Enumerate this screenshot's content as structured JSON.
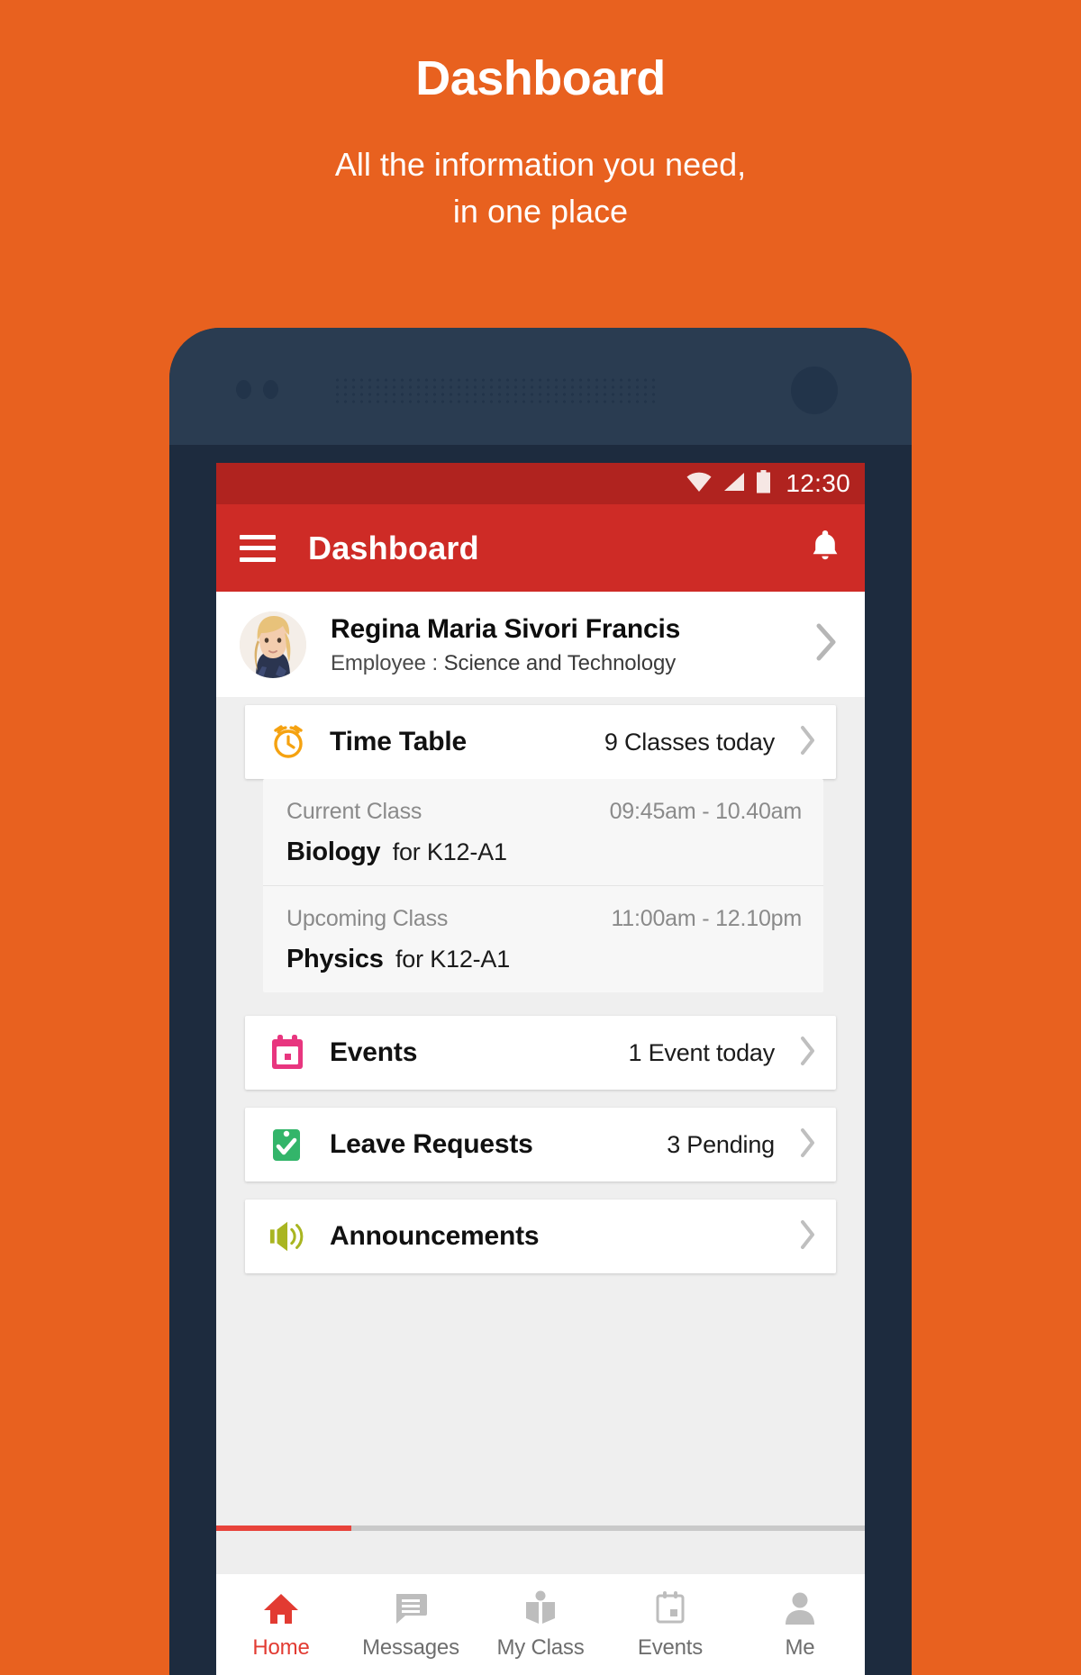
{
  "promo": {
    "title": "Dashboard",
    "subtitle_line1": "All the information you need,",
    "subtitle_line2": "in one place"
  },
  "colors": {
    "background": "#E8611F",
    "phone_frame": "#1D2B3E",
    "phone_frame_top": "#2A3C51",
    "statusbar": "#B0231F",
    "appbar": "#CE2B26",
    "accent_red": "#E23B32",
    "timetable_icon": "#F5A210",
    "events_icon": "#E8367F",
    "leave_icon": "#33B56A",
    "announcements_icon": "#A9B521"
  },
  "statusbar": {
    "time": "12:30",
    "icons": [
      "wifi-icon",
      "cellular-signal-icon",
      "battery-icon"
    ]
  },
  "appbar": {
    "menu_icon": "hamburger-menu-icon",
    "title": "Dashboard",
    "notification_icon": "bell-icon"
  },
  "profile": {
    "avatar": "user-avatar-photo",
    "name": "Regina Maria Sivori Francis",
    "role_label": "Employee :",
    "department": "Science and Technology",
    "chevron": "chevron-right-icon"
  },
  "cards": {
    "timetable": {
      "icon": "alarm-clock-icon",
      "title": "Time Table",
      "meta": "9 Classes today",
      "chevron": "chevron-right-icon"
    },
    "events": {
      "icon": "calendar-icon",
      "title": "Events",
      "meta": "1 Event today",
      "chevron": "chevron-right-icon"
    },
    "leave_requests": {
      "icon": "clipboard-check-icon",
      "title": "Leave Requests",
      "meta": "3 Pending",
      "chevron": "chevron-right-icon"
    },
    "announcements": {
      "icon": "megaphone-icon",
      "title": "Announcements",
      "meta": "",
      "chevron": "chevron-right-icon"
    }
  },
  "timetable_detail": [
    {
      "label": "Current Class",
      "time": "09:45am - 10.40am",
      "subject": "Biology",
      "class": "for K12-A1"
    },
    {
      "label": "Upcoming Class",
      "time": "11:00am - 12.10pm",
      "subject": "Physics",
      "class": "for K12-A1"
    }
  ],
  "bottom_nav": {
    "items": [
      {
        "label": "Home",
        "icon": "home-icon",
        "active": true
      },
      {
        "label": "Messages",
        "icon": "message-icon",
        "active": false
      },
      {
        "label": "My Class",
        "icon": "book-icon",
        "active": false
      },
      {
        "label": "Events",
        "icon": "calendar-icon",
        "active": false
      },
      {
        "label": "Me",
        "icon": "person-icon",
        "active": false
      }
    ]
  }
}
